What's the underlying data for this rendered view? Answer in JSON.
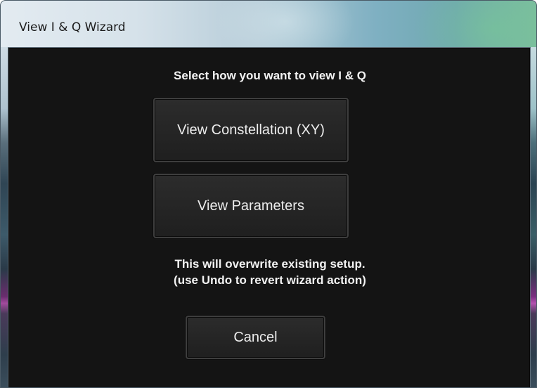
{
  "window": {
    "title": "View I & Q Wizard"
  },
  "dialog": {
    "heading": "Select how you want to view I & Q",
    "buttons": {
      "constellation_label": "View Constellation (XY)",
      "parameters_label": "View Parameters",
      "cancel_label": "Cancel"
    },
    "warning_line1": "This will overwrite existing setup.",
    "warning_line2": "(use Undo to revert wizard action)"
  },
  "colors": {
    "dialog_background": "#141414",
    "button_background": "#262626",
    "text": "#f2f2f2",
    "title_bar": "#b6ccd8"
  }
}
